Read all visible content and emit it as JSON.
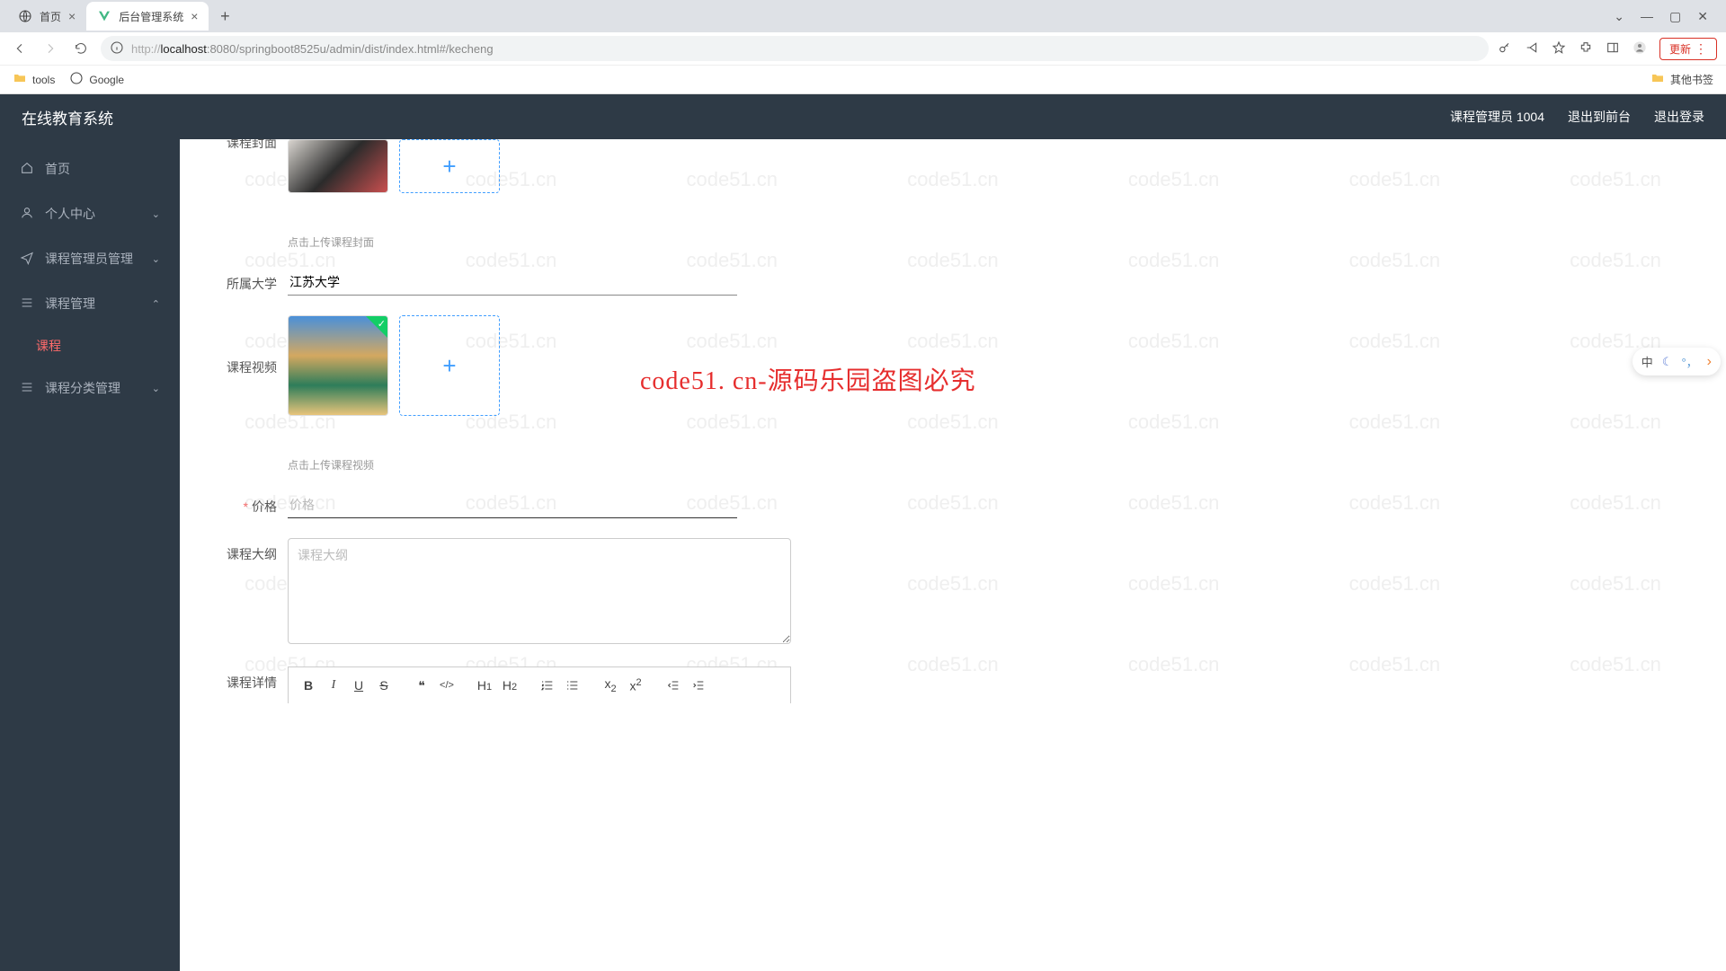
{
  "browser": {
    "tabs": [
      {
        "title": "首页",
        "active": false
      },
      {
        "title": "后台管理系统",
        "active": true
      }
    ],
    "url_protocol": "http://",
    "url_host": "localhost",
    "url_path": ":8080/springboot8525u/admin/dist/index.html#/kecheng",
    "update_label": "更新",
    "bookmarks": {
      "tools": "tools",
      "google": "Google",
      "other": "其他书签"
    }
  },
  "topbar": {
    "brand": "在线教育系统",
    "user_role": "课程管理员 1004",
    "exit_front": "退出到前台",
    "logout": "退出登录"
  },
  "sidebar": {
    "items": [
      {
        "label": "首页",
        "icon": "home"
      },
      {
        "label": "个人中心",
        "icon": "user",
        "expandable": true
      },
      {
        "label": "课程管理员管理",
        "icon": "send",
        "expandable": true
      },
      {
        "label": "课程管理",
        "icon": "list",
        "expandable": true,
        "expanded": true
      },
      {
        "label": "课程",
        "sub": true,
        "active": true
      },
      {
        "label": "课程分类管理",
        "icon": "list",
        "expandable": true
      }
    ]
  },
  "form": {
    "cover_label": "课程封面",
    "cover_hint": "点击上传课程封面",
    "university_label": "所属大学",
    "university_value": "江苏大学",
    "video_label": "课程视频",
    "video_hint": "点击上传课程视频",
    "price_label": "价格",
    "price_placeholder": "价格",
    "outline_label": "课程大纲",
    "outline_placeholder": "课程大纲",
    "detail_label": "课程详情"
  },
  "editor_toolbar": {
    "bold": "B",
    "italic": "I",
    "underline": "U",
    "strike": "S",
    "quote": "❝",
    "code": "</>",
    "h1": "H₁",
    "h2": "H₂",
    "ol": "list-ol",
    "ul": "list-ul",
    "sub": "x₂",
    "sup": "x²",
    "outdent": "outdent",
    "indent": "indent"
  },
  "overlay_watermark_text": "code51. cn-源码乐园盗图必究",
  "watermark_repeat": "code51.cn",
  "ime": {
    "mode": "中"
  }
}
